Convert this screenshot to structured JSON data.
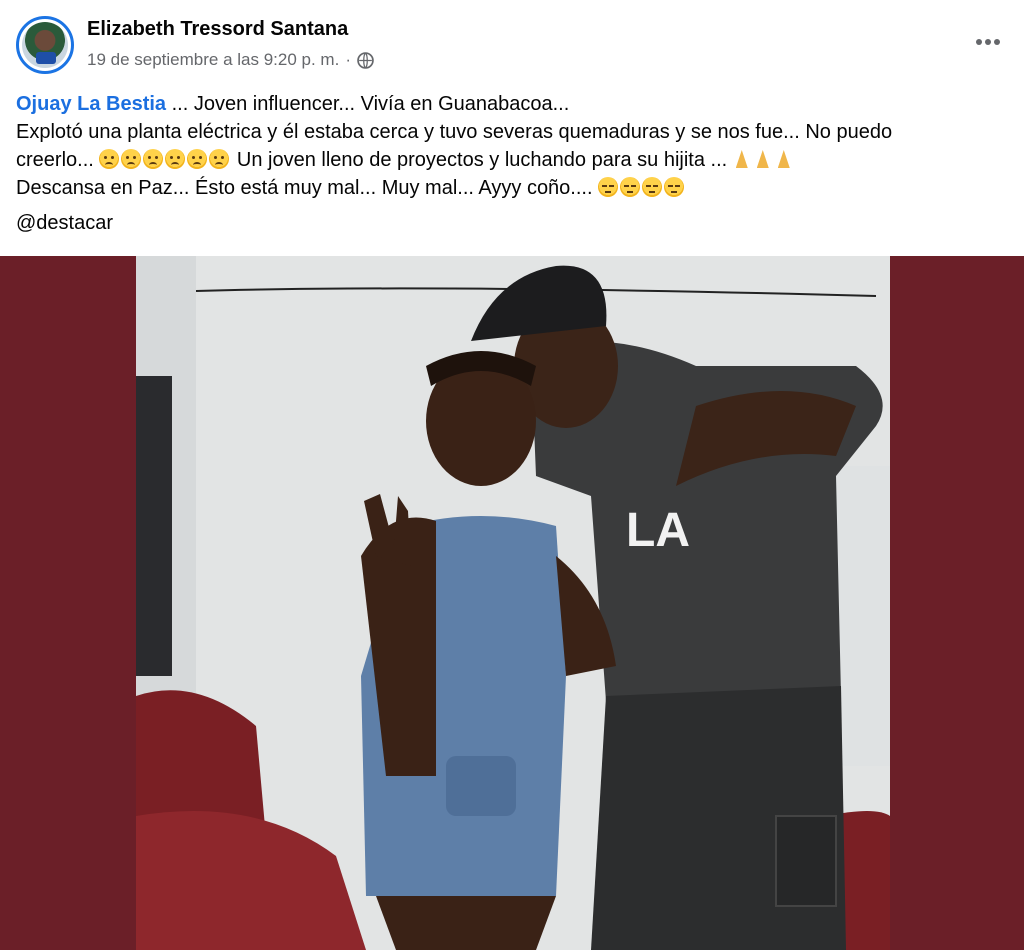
{
  "post": {
    "author": "Elizabeth Tressord Santana",
    "timestamp": "19 de septiembre a las 9:20 p. m.",
    "separator": "·",
    "audience_icon": "globe-icon",
    "more_icon": "more-options-icon",
    "text": {
      "mention": "Ojuay La Bestia",
      "line1_rest": " ... Joven influencer... Vivía en Guanabacoa...",
      "line2": "Explotó una planta eléctrica y él estaba cerca y tuvo severas quemaduras y se nos fue... No puedo",
      "line3_start": "creerlo... ",
      "line3_mid": " Un joven lleno de proyectos y luchando para su hijita ... ",
      "line4_start": "Descansa en Paz... Ésto está muy mal... Muy mal... Ayyy coño.... "
    },
    "hashtag": "@destacar"
  },
  "photo": {
    "description_icon": "post-photo",
    "frame_color": "#6b1f28"
  },
  "colors": {
    "link": "#1b6fe0",
    "meta": "#65676b",
    "avatar_ring": "#1b74e4"
  }
}
